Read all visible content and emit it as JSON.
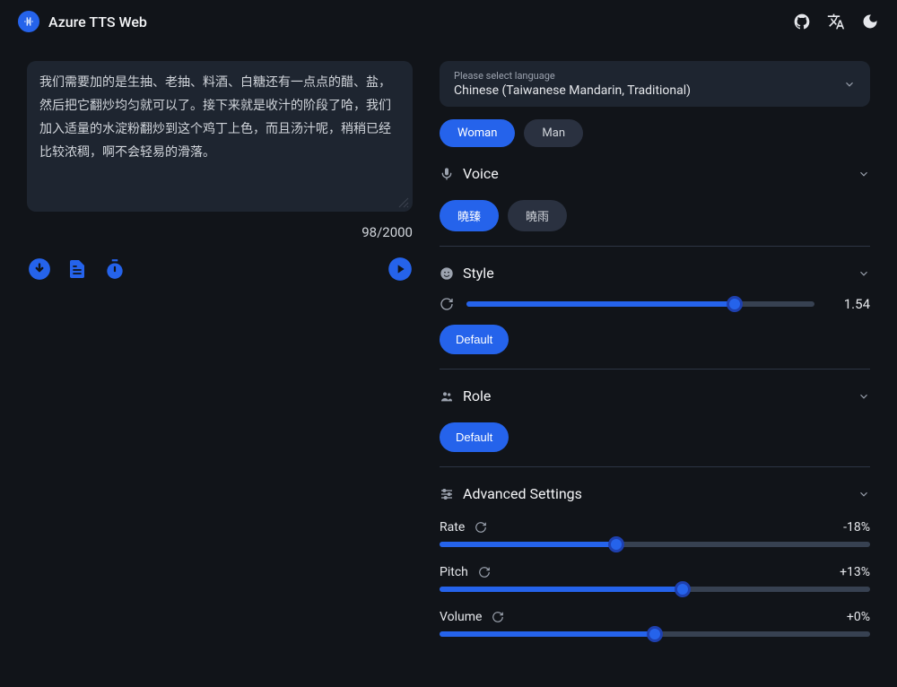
{
  "header": {
    "title": "Azure TTS Web"
  },
  "textInput": {
    "content": "我们需要加的是生抽、老抽、料酒、白糖还有一点点的醋、盐，然后把它翻炒均匀就可以了。接下来就是收汁的阶段了哈，我们加入适量的水淀粉翻炒到这个鸡丁上色，而且汤汁呢，稍稍已经比较浓稠，啊不会轻易的滑落。",
    "counter": "98/2000"
  },
  "language": {
    "placeholder": "Please select language",
    "value": "Chinese (Taiwanese Mandarin, Traditional)"
  },
  "gender": {
    "options": [
      "Woman",
      "Man"
    ],
    "selected": "Woman"
  },
  "voice": {
    "title": "Voice",
    "options": [
      "曉臻",
      "曉雨"
    ],
    "selected": "曉臻"
  },
  "style": {
    "title": "Style",
    "value": "1.54",
    "percent": 77,
    "defaultLabel": "Default"
  },
  "role": {
    "title": "Role",
    "defaultLabel": "Default"
  },
  "advanced": {
    "title": "Advanced Settings",
    "rate": {
      "label": "Rate",
      "value": "-18%",
      "percent": 41
    },
    "pitch": {
      "label": "Pitch",
      "value": "+13%",
      "percent": 56.5
    },
    "volume": {
      "label": "Volume",
      "value": "+0%",
      "percent": 50
    }
  }
}
